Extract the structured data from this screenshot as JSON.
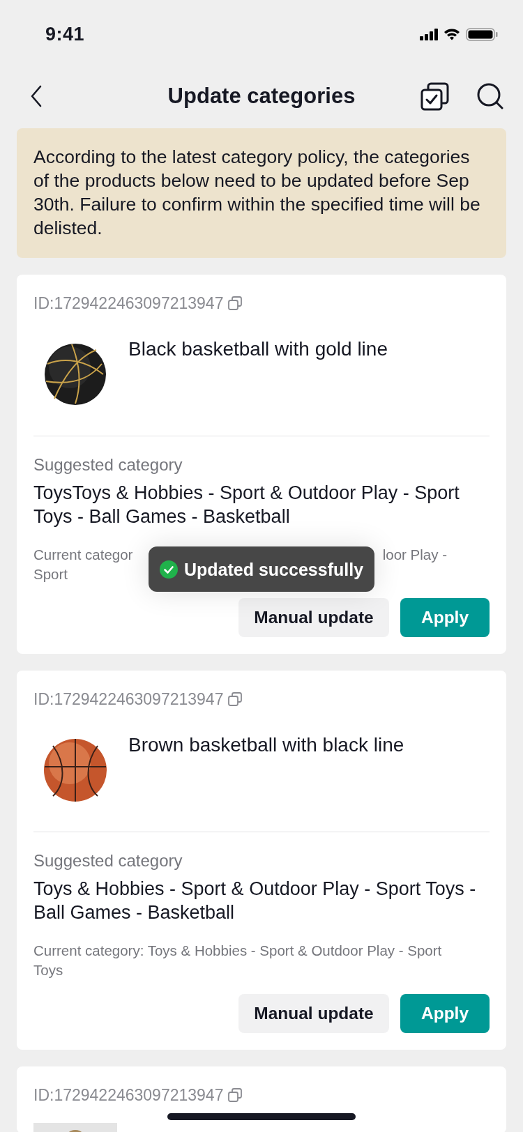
{
  "status_bar": {
    "time": "9:41"
  },
  "nav": {
    "title": "Update categories"
  },
  "notice": "According to the latest category policy, the categories of the products below need to be updated before Sep 30th. Failure to confirm within the specified time will be delisted.",
  "products": [
    {
      "id": "ID:1729422463097213947",
      "title": "Black basketball with gold line",
      "suggested_label": "Suggested category",
      "suggested": "ToysToys & Hobbies - Sport & Outdoor Play - Sport Toys - Ball Games - Basketball",
      "current": [
        "Current categor",
        "loor Play -",
        "Sport"
      ],
      "buttons": [
        "Manual update",
        "Apply"
      ],
      "toast": "Updated successfully"
    },
    {
      "id": "ID:1729422463097213947",
      "title": "Brown basketball with black line",
      "suggested_label": "Suggested category",
      "suggested": "Toys & Hobbies - Sport & Outdoor Play - Sport Toys - Ball Games - Basketball",
      "current": [
        "Current category: Toys & Hobbies - Sport & Outdoor Play - Sport Toys"
      ],
      "buttons": [
        "Manual update",
        "Apply"
      ]
    },
    {
      "id": "ID:1729422463097213947"
    }
  ]
}
